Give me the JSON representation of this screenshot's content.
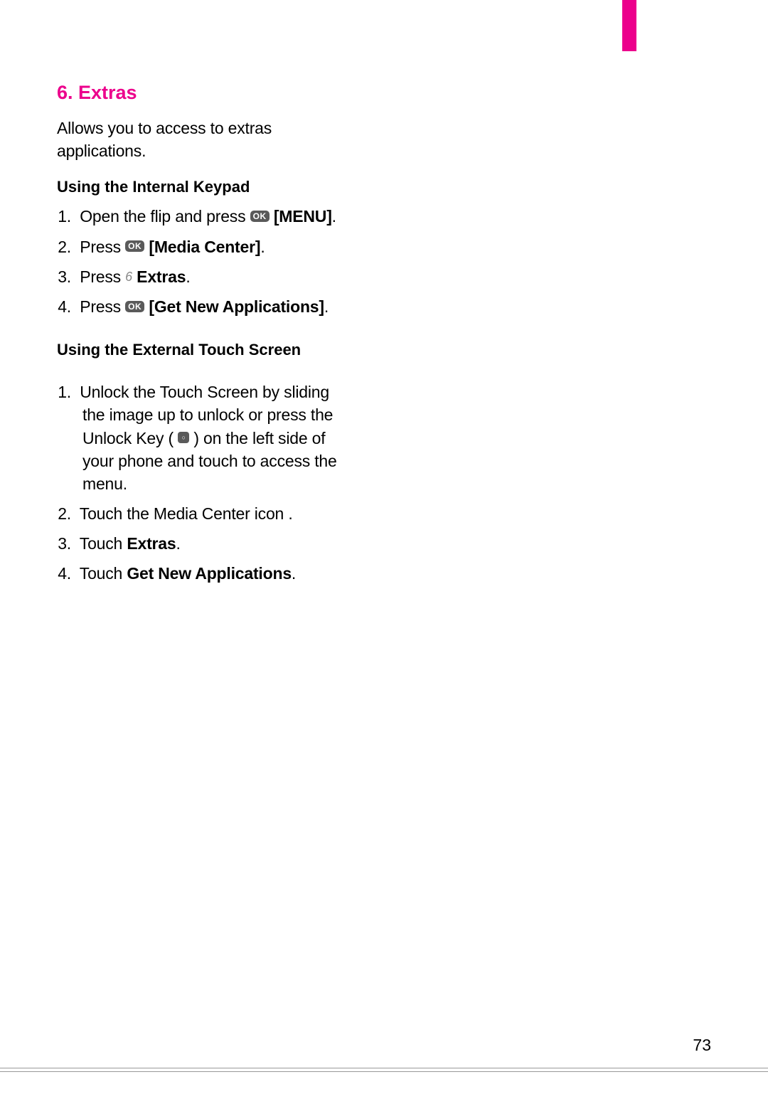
{
  "accent_color": "#ec008c",
  "page_number": "73",
  "section": {
    "number": "6",
    "title": "6. Extras",
    "intro": "Allows you to access to extras applications."
  },
  "subsection1": {
    "title": "Using the Internal Keypad",
    "steps": {
      "s1": {
        "num": "1.",
        "t1": " Open the flip and press  ",
        "t2": "[MENU]",
        "t3": "."
      },
      "s2": {
        "num": "2.",
        "t1": " Press  ",
        "t2": "  [Media Center]",
        "t3": "."
      },
      "s3": {
        "num": "3.",
        "t1": " Press  ",
        "t2": "  Extras",
        "t3": "."
      },
      "s4": {
        "num": "4.",
        "t1": " Press ",
        "t2": " [Get New Applications]",
        "t3": "."
      }
    }
  },
  "subsection2": {
    "title": "Using the External Touch Screen",
    "steps": {
      "s1": {
        "num": "1.",
        "t1": " Unlock the Touch Screen by sliding the image            up to unlock or press the Unlock Key ( ",
        "t2": " ) on the left side of your phone and touch           to access the menu."
      },
      "s2": {
        "num": "2.",
        "t1": " Touch the Media Center icon         ."
      },
      "s3": {
        "num": "3.",
        "t1": " Touch ",
        "t2": "Extras",
        "t3": "."
      },
      "s4": {
        "num": "4.",
        "t1": " Touch ",
        "t2": "Get New Applications",
        "t3": "."
      }
    }
  },
  "icons": {
    "ok": "OK",
    "key6": "6",
    "small": "○"
  }
}
